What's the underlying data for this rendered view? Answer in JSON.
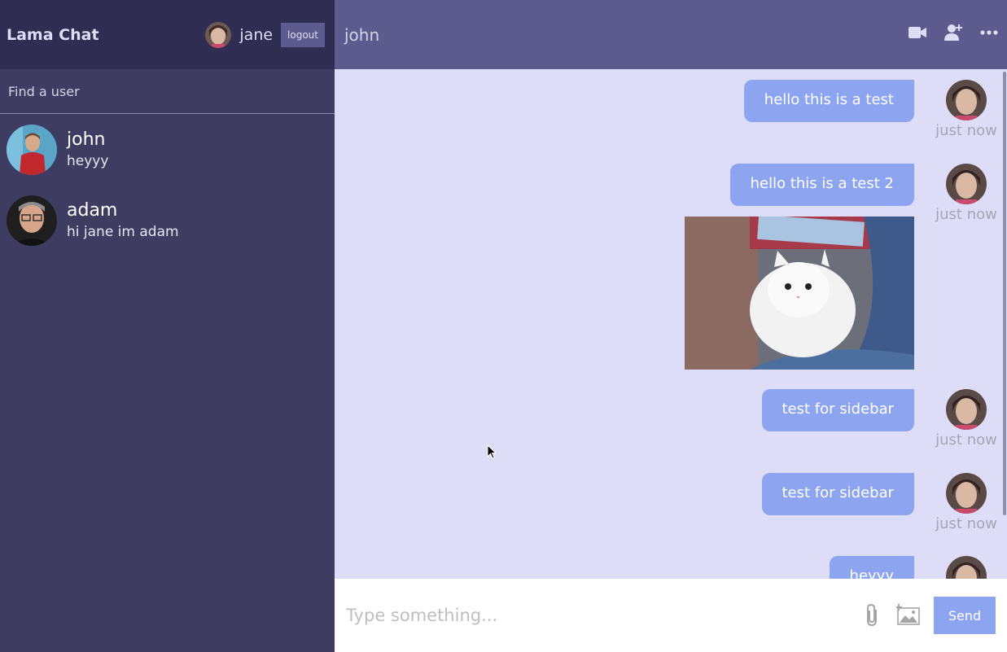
{
  "app": {
    "logo": "Lama Chat",
    "current_user": "jane",
    "logout_label": "logout"
  },
  "search": {
    "placeholder": "Find a user"
  },
  "user_chats": [
    {
      "name": "john",
      "last_message": "heyyy"
    },
    {
      "name": "adam",
      "last_message": "hi jane im adam"
    }
  ],
  "chat": {
    "title": "john",
    "icons": [
      "video-camera-icon",
      "add-user-icon",
      "more-options-icon"
    ]
  },
  "messages": [
    {
      "text": "hello this is a test",
      "time": "just now"
    },
    {
      "text": "hello this is a test 2",
      "time": "just now",
      "image": "white-kitten-photo"
    },
    {
      "text": "test for sidebar",
      "time": "just now"
    },
    {
      "text": "test for sidebar",
      "time": "just now"
    },
    {
      "text": "heyyy",
      "time": ""
    }
  ],
  "input": {
    "placeholder": "Type something...",
    "send_label": "Send",
    "icons": [
      "attach-icon",
      "image-icon"
    ]
  },
  "colors": {
    "sidebar_bg": "#3e3c61",
    "navbar_bg": "#2f2d52",
    "chat_header_bg": "#5d5b8d",
    "chat_bg": "#ddddf7",
    "bubble": "#8da4f1"
  }
}
